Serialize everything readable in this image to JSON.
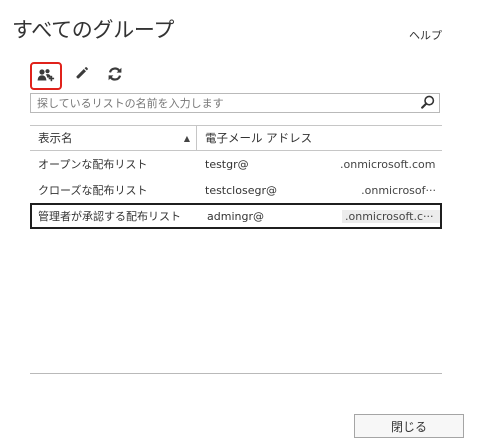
{
  "header": {
    "title": "すべてのグループ",
    "help_label": "ヘルプ"
  },
  "toolbar": {
    "buttons": [
      {
        "icon": "new-group-icon",
        "highlighted": true
      },
      {
        "icon": "edit-pencil-icon",
        "highlighted": false
      },
      {
        "icon": "refresh-icon",
        "highlighted": false
      }
    ],
    "highlight_color": "#e0221b"
  },
  "search": {
    "placeholder": "探しているリストの名前を入力します",
    "value": "",
    "icon": "search-icon"
  },
  "table": {
    "columns": [
      "表示名",
      "電子メール アドレス"
    ],
    "sorted_column": "表示名",
    "sort_direction": "ascending",
    "rows": [
      {
        "name": "オープンな配布リスト",
        "alias": "testgr@",
        "domain": ".onmicrosoft.com",
        "selected": false
      },
      {
        "name": "クローズな配布リスト",
        "alias": "testclosegr@",
        "domain": ".onmicrosof···",
        "selected": false
      },
      {
        "name": "管理者が承認する配布リスト",
        "alias": "admingr@",
        "domain": ".onmicrosoft.c···",
        "selected": true
      }
    ]
  },
  "footer": {
    "close_label": "閉じる"
  }
}
